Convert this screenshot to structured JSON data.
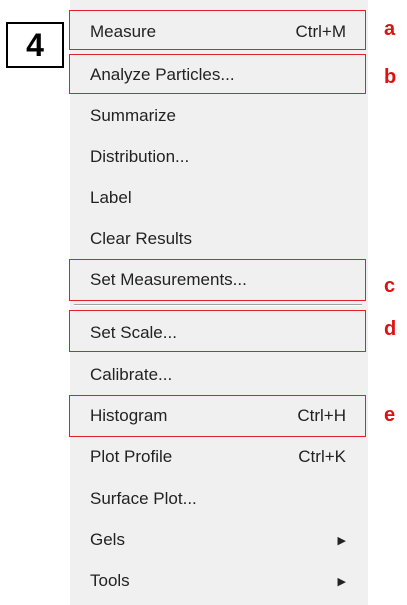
{
  "step": "4",
  "menu": {
    "items": [
      {
        "label": "Measure",
        "shortcut": "Ctrl+M",
        "submenu": false
      },
      {
        "label": "Analyze Particles...",
        "shortcut": "",
        "submenu": false
      },
      {
        "label": "Summarize",
        "shortcut": "",
        "submenu": false
      },
      {
        "label": "Distribution...",
        "shortcut": "",
        "submenu": false
      },
      {
        "label": "Label",
        "shortcut": "",
        "submenu": false
      },
      {
        "label": "Clear Results",
        "shortcut": "",
        "submenu": false
      },
      {
        "label": "Set Measurements...",
        "shortcut": "",
        "submenu": false
      },
      {
        "label": "Set Scale...",
        "shortcut": "",
        "submenu": false
      },
      {
        "label": "Calibrate...",
        "shortcut": "",
        "submenu": false
      },
      {
        "label": "Histogram",
        "shortcut": "Ctrl+H",
        "submenu": false
      },
      {
        "label": "Plot Profile",
        "shortcut": "Ctrl+K",
        "submenu": false
      },
      {
        "label": "Surface Plot...",
        "shortcut": "",
        "submenu": false
      },
      {
        "label": "Gels",
        "shortcut": "",
        "submenu": true
      },
      {
        "label": "Tools",
        "shortcut": "",
        "submenu": true
      }
    ]
  },
  "annotations": {
    "a": "a",
    "b": "b",
    "c": "c",
    "d": "d",
    "e": "e"
  },
  "colors": {
    "highlight": "#e0202a",
    "annotation": "#e01010",
    "menu_background": "#f0f0f0"
  }
}
